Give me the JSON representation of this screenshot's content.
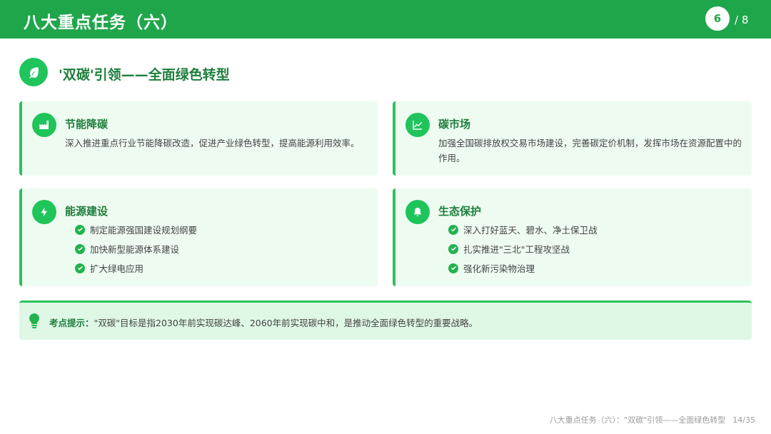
{
  "header": {
    "title": "八大重点任务（六）",
    "page_current": "6",
    "page_total": "/ 8"
  },
  "section": {
    "icon": "leaf-icon",
    "title": "'双碳'引领——全面绿色转型"
  },
  "cards": [
    {
      "icon": "factory-icon",
      "title": "节能降碳",
      "desc": "深入推进重点行业节能降碳改造，促进产业绿色转型，提高能源利用效率。"
    },
    {
      "icon": "chart-line-icon",
      "title": "碳市场",
      "desc": "加强全国碳排放权交易市场建设，完善碳定价机制，发挥市场在资源配置中的作用。"
    },
    {
      "icon": "lightning-icon",
      "title": "能源建设",
      "items": [
        "制定能源强国建设规划纲要",
        "加快新型能源体系建设",
        "扩大绿电应用"
      ]
    },
    {
      "icon": "bell-icon",
      "title": "生态保护",
      "items": [
        "深入打好蓝天、碧水、净土保卫战",
        "扎实推进\"三北\"工程攻坚战",
        "强化新污染物治理"
      ]
    }
  ],
  "tip": {
    "icon": "lightbulb-icon",
    "label": "考点提示：",
    "text": "\"双碳\"目标是指2030年前实现碳达峰、2060年前实现碳中和，是推动全面绿色转型的重要战略。"
  },
  "footer": {
    "text": "八大重点任务（六）：\"双碳\"引领——全面绿色转型",
    "page": "14/35"
  },
  "colors": {
    "header_green": "#1fa64a",
    "accent_green": "#1fc45a",
    "title_green": "#1e7e3c",
    "card_bg": "#eefbf1",
    "tip_bg": "#dff7e5"
  }
}
